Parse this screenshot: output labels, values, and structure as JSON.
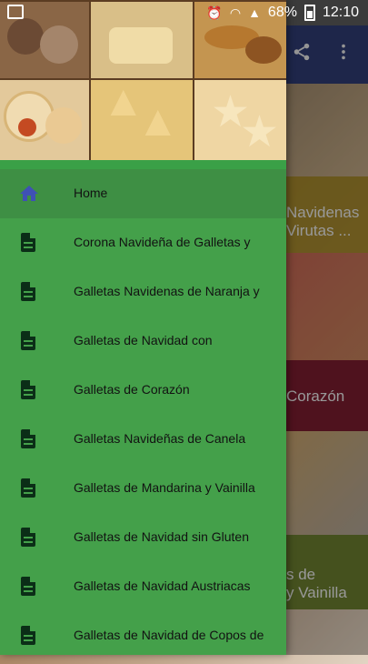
{
  "status_bar": {
    "battery_percent": "68%",
    "time": "12:10"
  },
  "app_bar": {
    "share_icon": "share-icon",
    "more_icon": "more-vert-icon"
  },
  "background_list": [
    {
      "title_line1": "Navidenas",
      "title_line2": "Virutas ..."
    },
    {
      "title_line1": "Corazón"
    },
    {
      "title_line1": "s de",
      "title_line2": "y Vainilla"
    }
  ],
  "drawer": {
    "header_image": "christmas-cookies-crate",
    "items": [
      {
        "label": "Home",
        "icon": "home-icon",
        "active": true
      },
      {
        "label": "Corona Navideña de Galletas y",
        "icon": "document-icon"
      },
      {
        "label": "Galletas Navidenas de Naranja y",
        "icon": "document-icon"
      },
      {
        "label": "Galletas de Navidad con",
        "icon": "document-icon"
      },
      {
        "label": "Galletas de Corazón",
        "icon": "document-icon"
      },
      {
        "label": "Galletas Navideñas de Canela",
        "icon": "document-icon"
      },
      {
        "label": "Galletas de Mandarina y Vainilla",
        "icon": "document-icon"
      },
      {
        "label": "Galletas de Navidad sin Gluten",
        "icon": "document-icon"
      },
      {
        "label": "Galletas de Navidad Austriacas",
        "icon": "document-icon"
      },
      {
        "label": "Galletas de Navidad de Copos de",
        "icon": "document-icon"
      }
    ]
  },
  "colors": {
    "drawer_bg": "#44a04a",
    "active_item_bg": "#3e8f44",
    "home_icon": "#3f51b5",
    "doc_icon": "#0b2e17",
    "app_bar_bg": "#2f3b72"
  }
}
